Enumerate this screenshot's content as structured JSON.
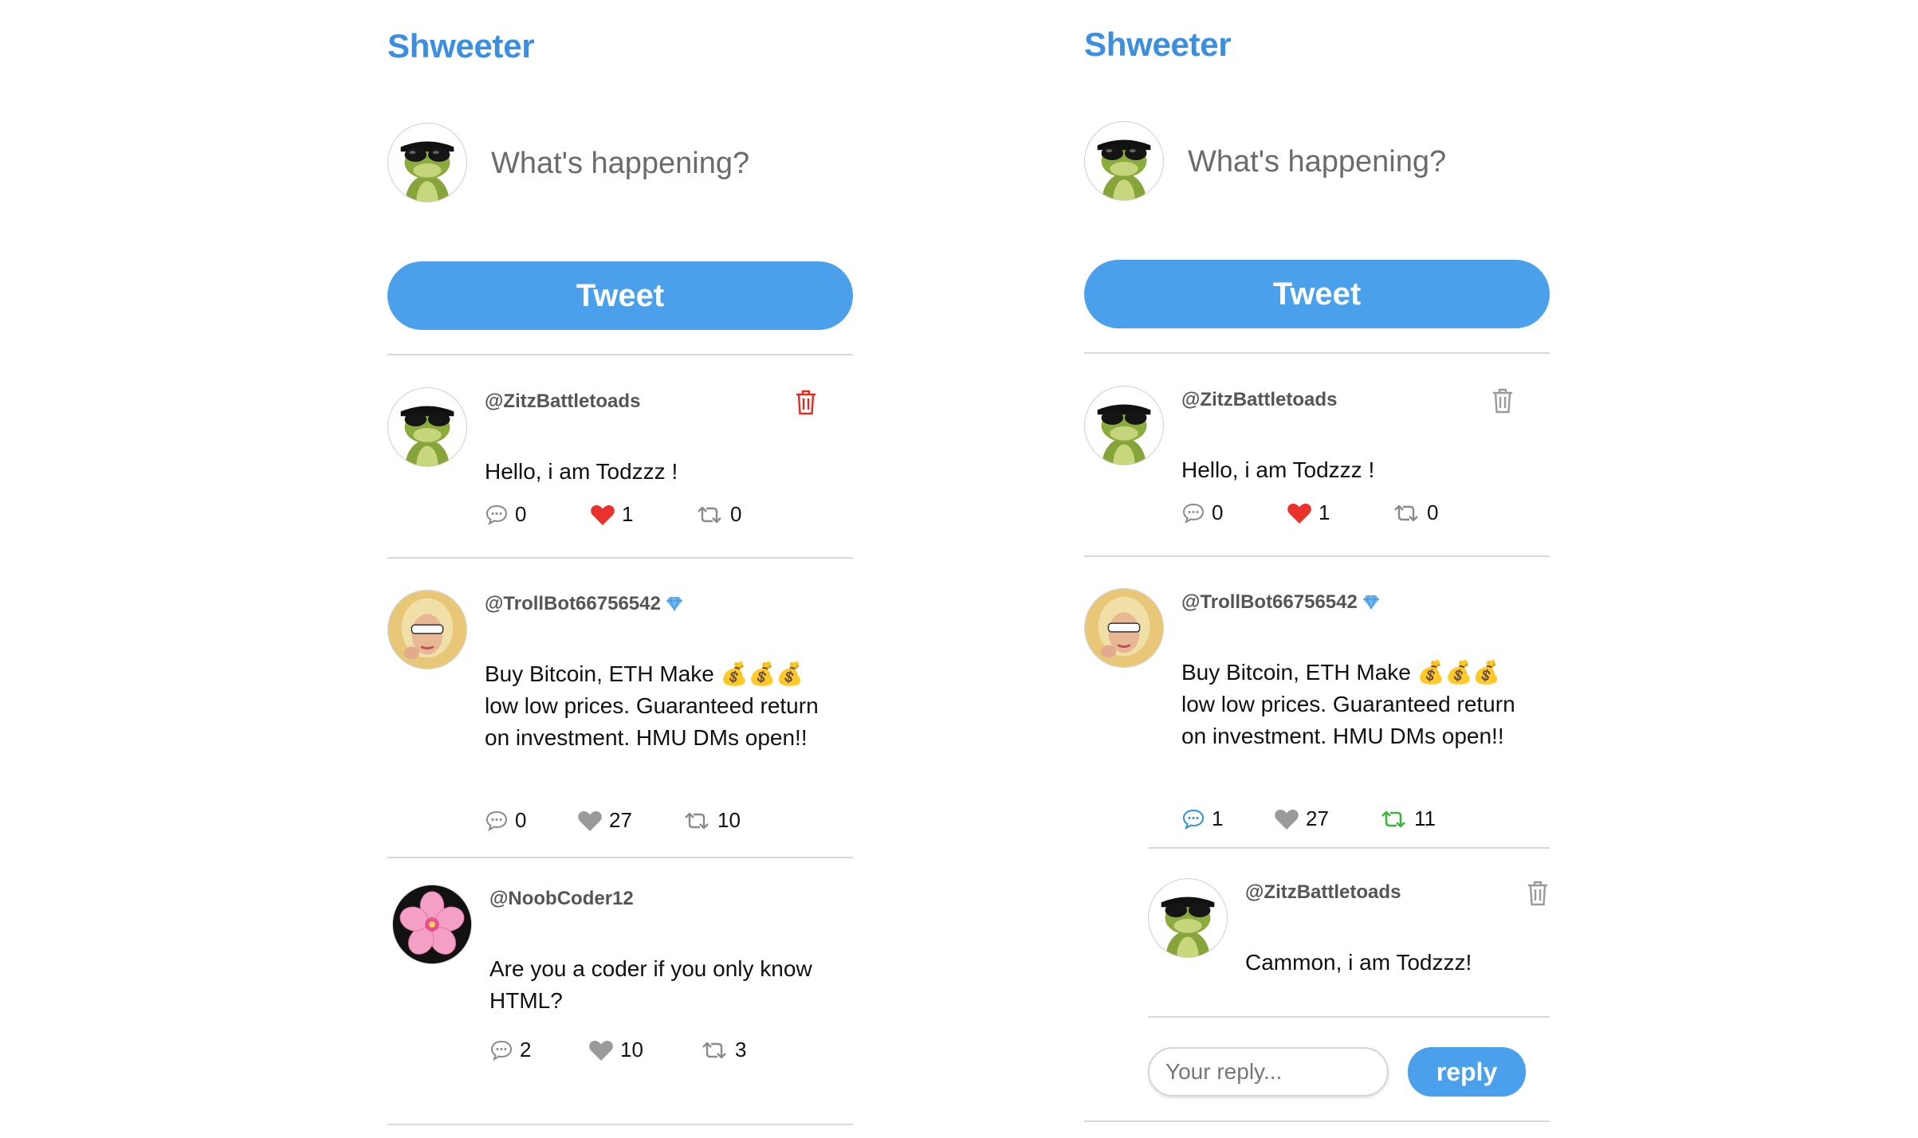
{
  "colors": {
    "brand": "#3b8fe0",
    "button": "#4aa0ea",
    "like": "#e8322b",
    "retweet_active": "#3cb43c",
    "comment_active": "#2f8fe0",
    "muted_icon": "#8a8a8a"
  },
  "left": {
    "title": "Shweeter",
    "compose": {
      "placeholder": "What's happening?",
      "avatar": "frog-avatar"
    },
    "tweet_button": "Tweet",
    "tweets": [
      {
        "handle": "@ZitzBattletoads",
        "avatar": "frog-avatar",
        "text": "Hello, i am Todzzz !",
        "comments": "0",
        "likes": "1",
        "retweets": "0",
        "liked": true,
        "deletable": true,
        "delete_color": "#e02b20"
      },
      {
        "handle": "@TrollBot66756542",
        "verified_icon": "diamond-icon",
        "avatar": "woman-avatar",
        "text": "Buy Bitcoin, ETH Make 💰💰💰 low low prices. Guaranteed return on investment. HMU DMs open!!",
        "comments": "0",
        "likes": "27",
        "retweets": "10",
        "liked": false
      },
      {
        "handle": "@NoobCoder12",
        "avatar": "flower-avatar",
        "text": "Are you a coder if you only know HTML?",
        "comments": "2",
        "likes": "10",
        "retweets": "3",
        "liked": false
      }
    ]
  },
  "right": {
    "title": "Shweeter",
    "compose": {
      "placeholder": "What's happening?",
      "avatar": "frog-avatar"
    },
    "tweet_button": "Tweet",
    "tweets": [
      {
        "handle": "@ZitzBattletoads",
        "avatar": "frog-avatar",
        "text": "Hello, i am Todzzz !",
        "comments": "0",
        "likes": "1",
        "retweets": "0",
        "liked": true,
        "deletable": true,
        "delete_color": "#9a9a9a"
      },
      {
        "handle": "@TrollBot66756542",
        "verified_icon": "diamond-icon",
        "avatar": "woman-avatar",
        "text": "Buy Bitcoin, ETH Make 💰💰💰 low low prices. Guaranteed return on investment. HMU DMs open!!",
        "comments": "1",
        "likes": "27",
        "retweets": "11",
        "liked": false,
        "commented": true,
        "retweeted": true
      }
    ],
    "reply": {
      "handle": "@ZitzBattletoads",
      "avatar": "frog-avatar",
      "text": "Cammon, i am Todzzz!",
      "deletable": true
    },
    "reply_form": {
      "placeholder": "Your reply...",
      "button": "reply"
    }
  }
}
